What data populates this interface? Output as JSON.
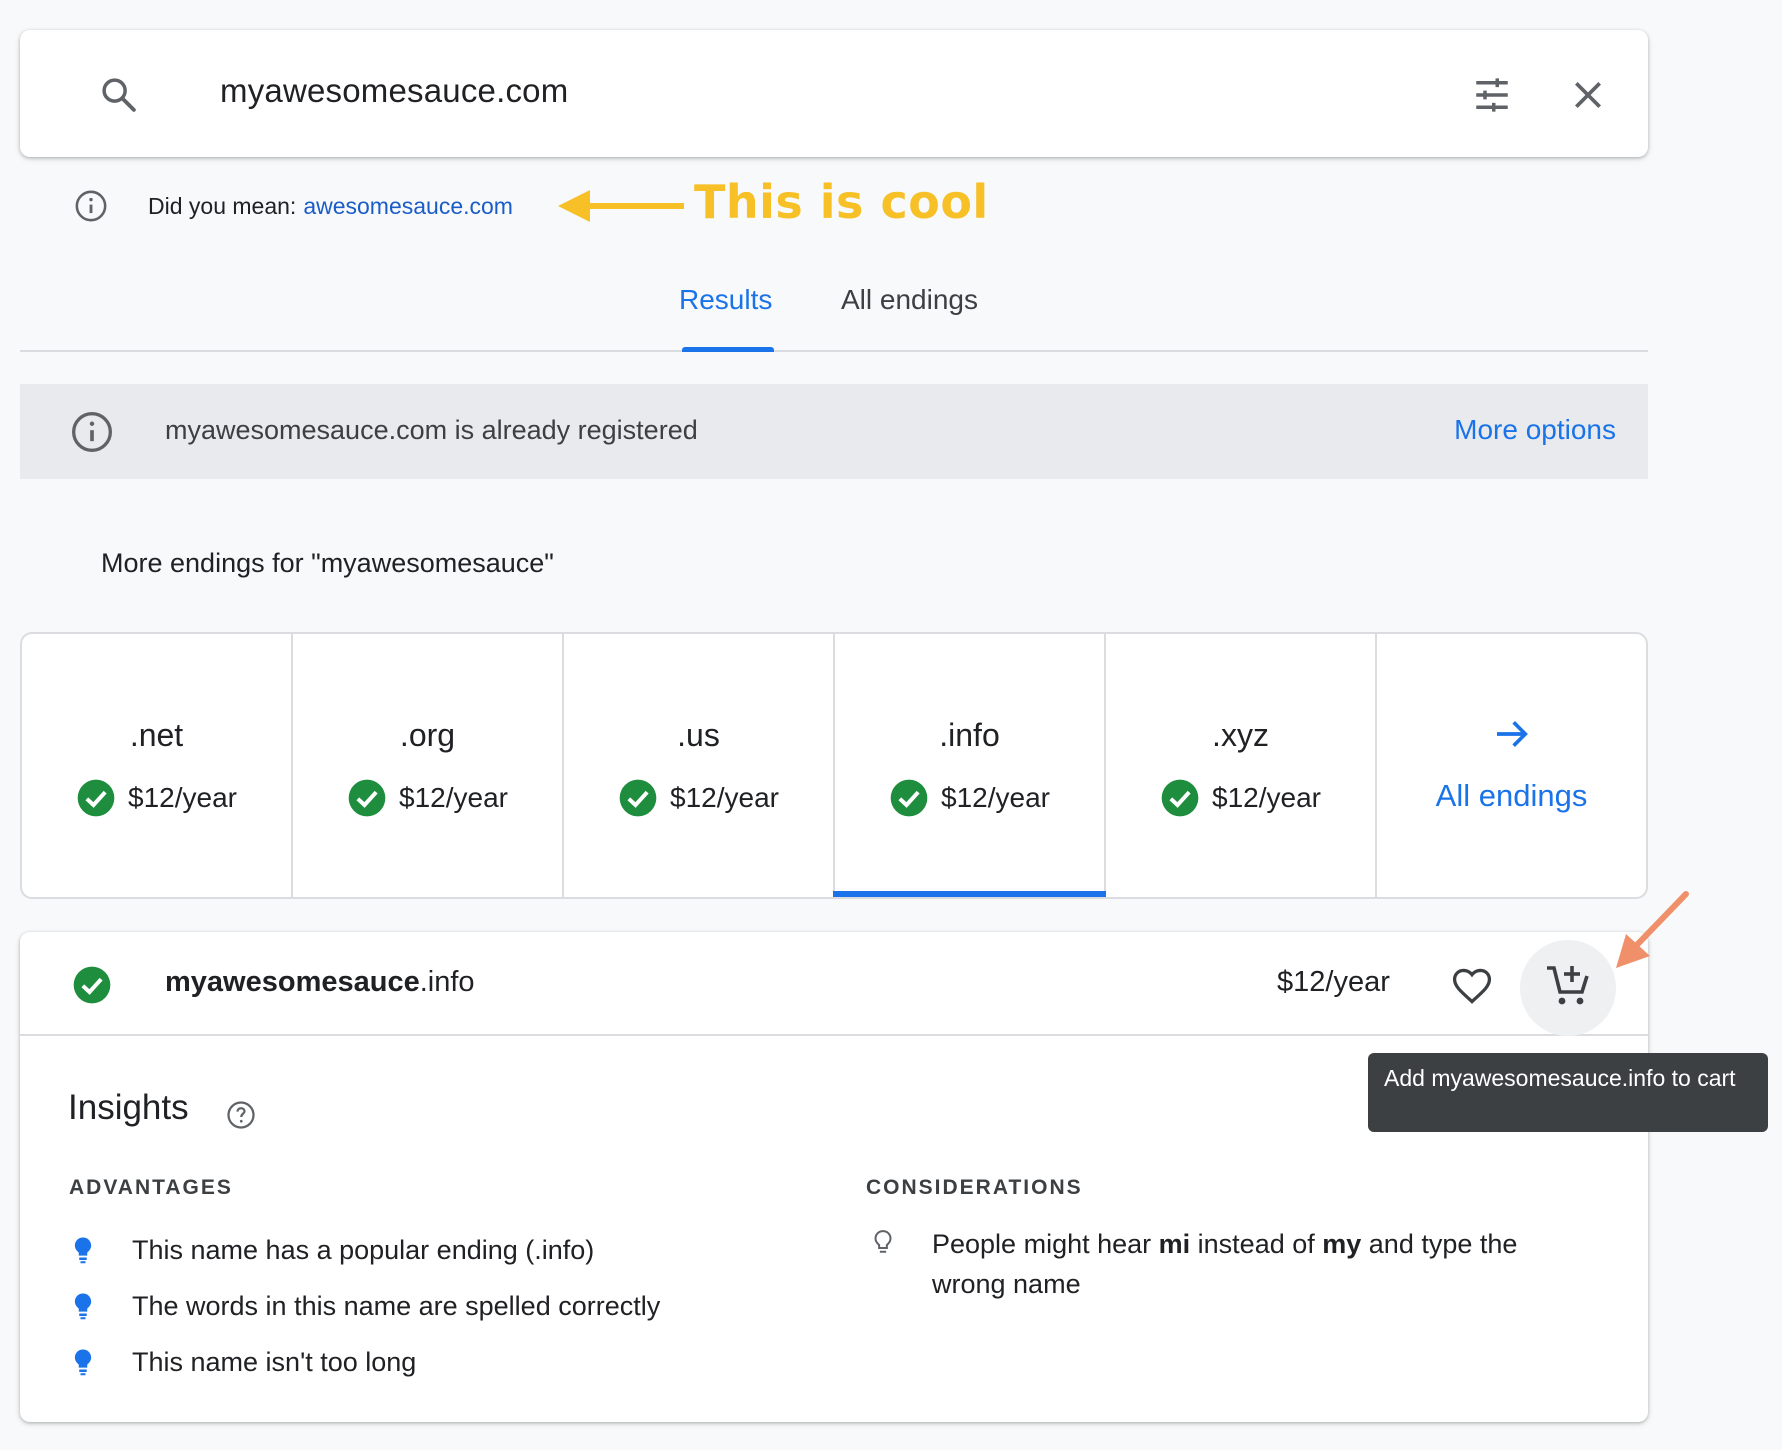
{
  "search": {
    "query": "myawesomesauce.com"
  },
  "did_you_mean": {
    "label": "Did you mean:",
    "suggestion": "awesomesauce.com"
  },
  "annotation": {
    "text": "This is cool",
    "color": "#f6c026",
    "arrow_color_secondary": "#f0906a"
  },
  "tabs": [
    {
      "label": "Results",
      "active": true
    },
    {
      "label": "All endings",
      "active": false
    }
  ],
  "banner": {
    "text": "myawesomesauce.com is already registered",
    "link": "More options"
  },
  "more_endings_title": "More endings for \"myawesomesauce\"",
  "endings": [
    {
      "tld": ".net",
      "price": "$12/year"
    },
    {
      "tld": ".org",
      "price": "$12/year"
    },
    {
      "tld": ".us",
      "price": "$12/year"
    },
    {
      "tld": ".info",
      "price": "$12/year",
      "selected": true
    },
    {
      "tld": ".xyz",
      "price": "$12/year"
    }
  ],
  "all_endings_label": "All endings",
  "result": {
    "domain_name": "myawesomesauce",
    "domain_tld": ".info",
    "price": "$12/year",
    "tooltip": "Add myawesomesauce.info to cart"
  },
  "insights": {
    "title": "Insights",
    "advantages_label": "ADVANTAGES",
    "considerations_label": "CONSIDERATIONS",
    "advantages": [
      "This name has a popular ending (.info)",
      "The words in this name are spelled correctly",
      "This name isn't too long"
    ],
    "consideration": {
      "part1": "People might hear ",
      "bold1": "mi",
      "part2": " instead of ",
      "bold2": "my",
      "part3": " and type the wrong name"
    }
  },
  "colors": {
    "accent": "#1a73e8",
    "success": "#1e8e3e",
    "link": "#1a5cc8"
  },
  "icons": [
    "search-icon",
    "tune-icon",
    "close-icon",
    "info-icon",
    "check-circle-icon",
    "arrow-right-icon",
    "heart-icon",
    "add-cart-icon",
    "help-icon",
    "lightbulb-icon"
  ]
}
